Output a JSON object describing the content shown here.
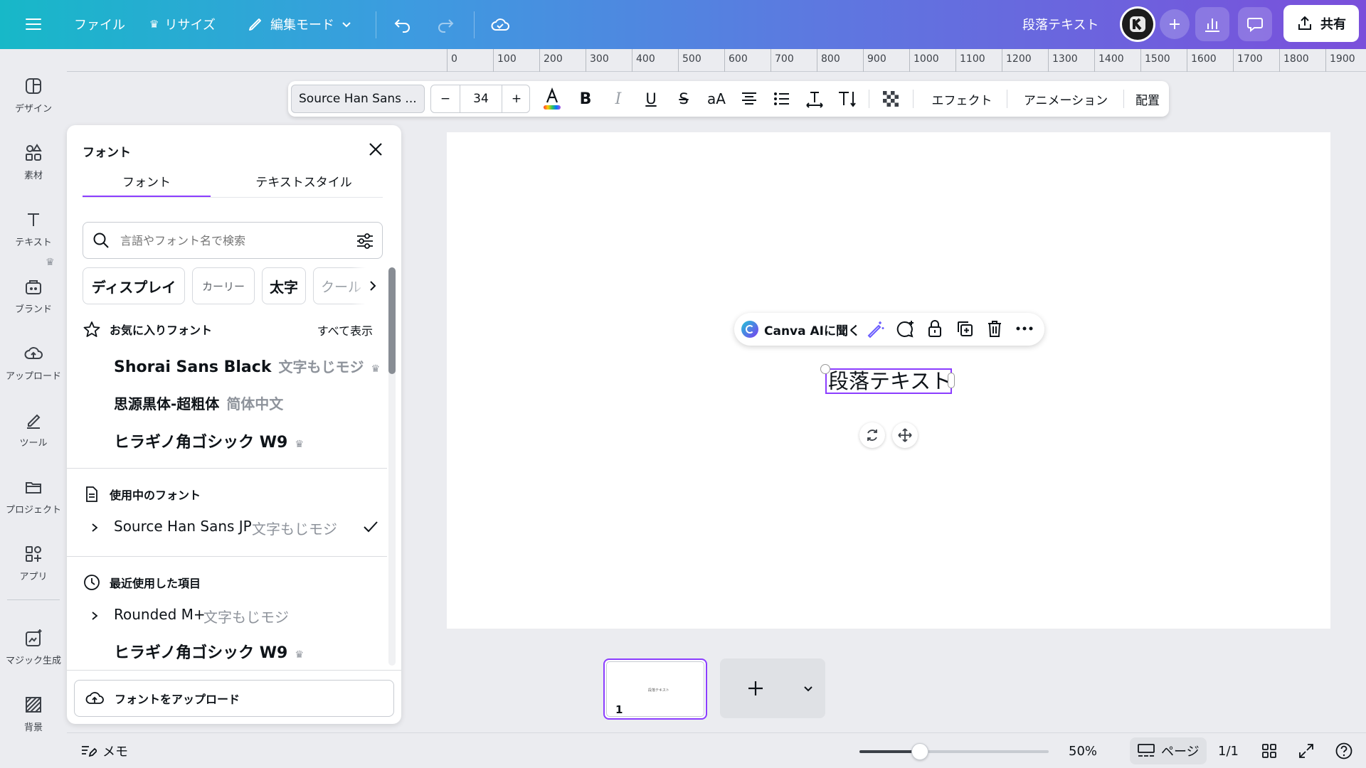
{
  "topbar": {
    "menu_icon": "hamburger-icon",
    "file": "ファイル",
    "resize": "リサイズ",
    "edit_mode": "編集モード",
    "doc_title": "段落テキスト",
    "share": "共有"
  },
  "rail": {
    "items": [
      {
        "label": "デザイン",
        "icon": "design-icon"
      },
      {
        "label": "素材",
        "icon": "elements-icon"
      },
      {
        "label": "テキスト",
        "icon": "text-icon"
      },
      {
        "label": "ブランド",
        "icon": "brand-icon"
      },
      {
        "label": "アップロード",
        "icon": "upload-icon"
      },
      {
        "label": "ツール",
        "icon": "tools-icon"
      },
      {
        "label": "プロジェクト",
        "icon": "projects-icon"
      },
      {
        "label": "アプリ",
        "icon": "apps-icon"
      },
      {
        "label": "マジック生成",
        "icon": "magic-icon"
      },
      {
        "label": "背景",
        "icon": "background-icon"
      }
    ]
  },
  "panel": {
    "title": "フォント",
    "tabs": [
      "フォント",
      "テキストスタイル"
    ],
    "search_placeholder": "言語やフォント名で検索",
    "chips": [
      "ディスプレイ",
      "カーリー",
      "太字",
      "クール"
    ],
    "favorites": {
      "heading": "お気に入りフォント",
      "see_all": "すべて表示",
      "fonts": [
        {
          "name": "Shorai Sans Black",
          "sample": "文字もじモジ",
          "premium": true
        },
        {
          "name": "思源黒体-超粗体",
          "sample": "简体中文",
          "premium": false
        },
        {
          "name": "ヒラギノ角ゴシック W9",
          "sample": "",
          "premium": true
        }
      ]
    },
    "in_use": {
      "heading": "使用中のフォント",
      "fonts": [
        {
          "name": "Source Han Sans JP",
          "sample": "文字もじモジ"
        }
      ]
    },
    "recent": {
      "heading": "最近使用した項目",
      "fonts": [
        {
          "name": "Rounded M+",
          "sample": "文字もじモジ"
        },
        {
          "name": "ヒラギノ角ゴシック W9",
          "sample": ""
        }
      ]
    },
    "upload": "フォントをアップロード"
  },
  "ruler": {
    "ticks": [
      "0",
      "100",
      "200",
      "300",
      "400",
      "500",
      "600",
      "700",
      "800",
      "900",
      "1000",
      "1100",
      "1200",
      "1300",
      "1400",
      "1500",
      "1600",
      "1700",
      "1800",
      "1900"
    ]
  },
  "text_toolbar": {
    "font": "Source Han Sans ...",
    "size": "34",
    "minus": "−",
    "plus": "+",
    "bold": "B",
    "italic": "I",
    "underline": "U",
    "strike": "S",
    "case": "aA",
    "effects": "エフェクト",
    "animation": "アニメーション",
    "position": "配置"
  },
  "context_bar": {
    "ask_ai": "Canva AIに聞く"
  },
  "canvas": {
    "text": "段落テキスト"
  },
  "pages": {
    "thumb_number": "1",
    "thumb_text": "段落テキスト"
  },
  "bottombar": {
    "notes": "メモ",
    "zoom_percent": "50%",
    "zoom_level": 0.3,
    "pages_label": "ページ",
    "page_count": "1/1"
  },
  "colors": {
    "accent": "#8b3dff"
  }
}
